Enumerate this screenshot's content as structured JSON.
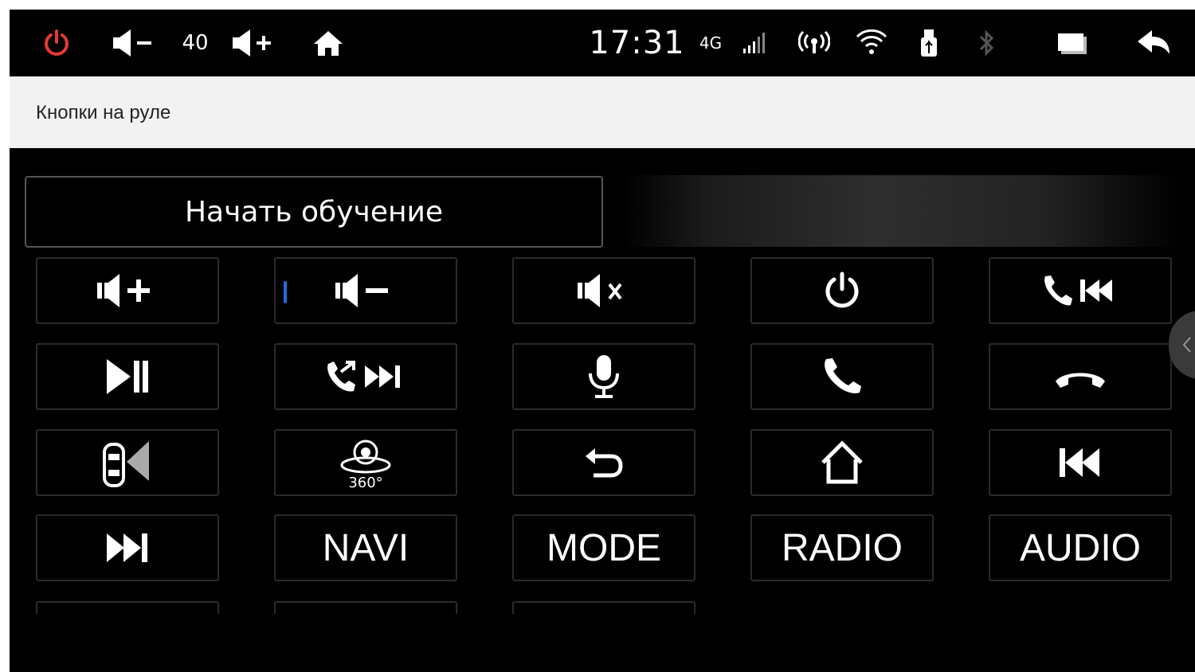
{
  "status_bar": {
    "volume_level": "40",
    "clock": "17:31",
    "network_type": "4G",
    "icons": [
      "power-icon",
      "volume-down-icon",
      "volume-up-icon",
      "home-icon",
      "signal-icon",
      "hotspot-icon",
      "wifi-icon",
      "usb-icon",
      "bluetooth-icon",
      "window-icon",
      "back-icon"
    ],
    "colors": {
      "power": "#e53935",
      "bluetooth": "#555555"
    }
  },
  "title_bar": {
    "title": "Кнопки на руле"
  },
  "learn_button": {
    "label": "Начать обучение"
  },
  "keys": [
    {
      "icon": "volume-up-icon"
    },
    {
      "icon": "volume-down-icon",
      "selected": true
    },
    {
      "icon": "mute-icon"
    },
    {
      "icon": "power-icon"
    },
    {
      "icon": "call-prev-icon"
    },
    {
      "icon": "play-pause-icon"
    },
    {
      "icon": "hangup-next-icon"
    },
    {
      "icon": "microphone-icon"
    },
    {
      "icon": "phone-icon"
    },
    {
      "icon": "hang-up-icon"
    },
    {
      "icon": "car-radar-icon"
    },
    {
      "icon": "camera-360-icon"
    },
    {
      "icon": "back-arrow-icon"
    },
    {
      "icon": "home-icon"
    },
    {
      "icon": "previous-track-icon"
    },
    {
      "icon": "next-track-icon"
    },
    {
      "label": "NAVI"
    },
    {
      "label": "MODE"
    },
    {
      "label": "RADIO"
    },
    {
      "label": "AUDIO"
    }
  ],
  "accent_color": "#1e6fd8"
}
